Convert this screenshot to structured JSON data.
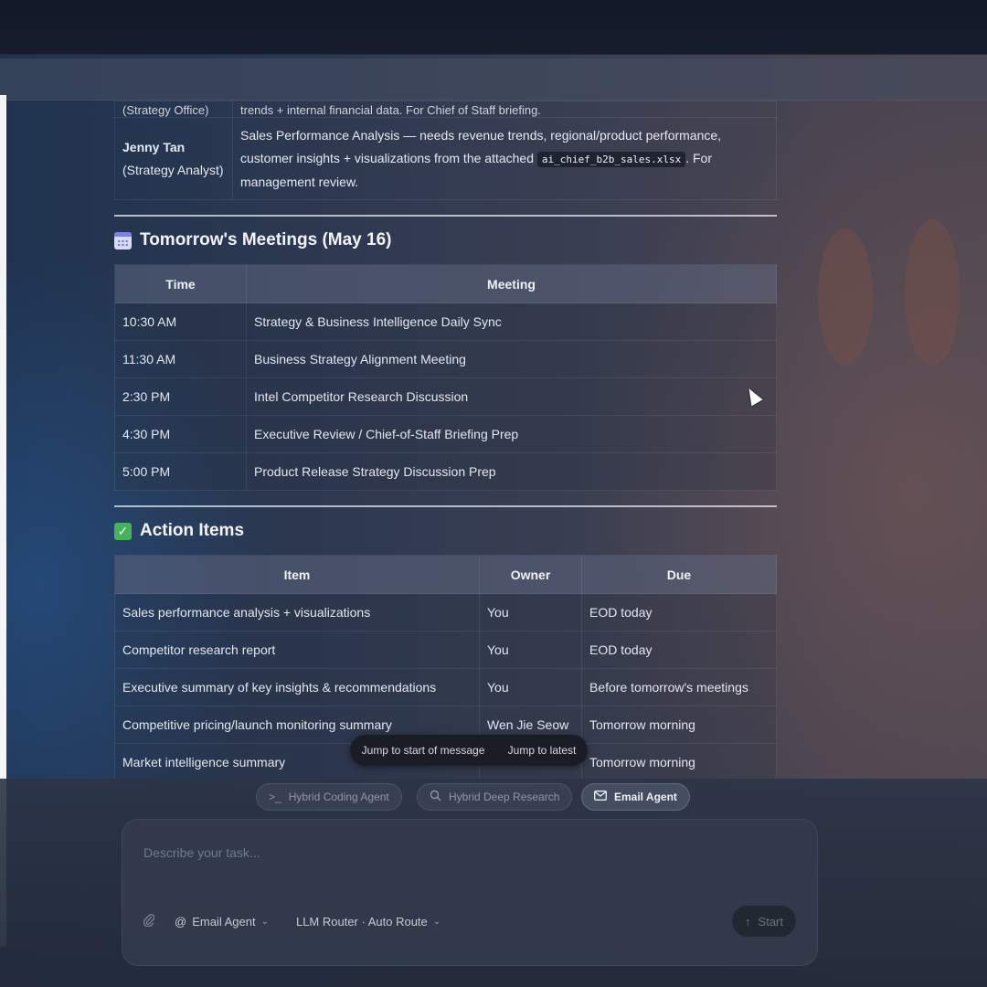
{
  "previous_row": {
    "who": "(Strategy Office)",
    "text": "trends + internal financial data. For Chief of Staff briefing."
  },
  "request_row": {
    "name": "Jenny Tan",
    "role": "(Strategy Analyst)",
    "text_before": "Sales Performance Analysis — needs revenue trends, regional/product performance, customer insights + visualizations from the attached",
    "file": "ai_chief_b2b_sales.xlsx",
    "text_after": ". For management review."
  },
  "meetings": {
    "title": "Tomorrow's Meetings (May 16)",
    "icon": "calendar-icon",
    "headers": [
      "Time",
      "Meeting"
    ],
    "rows": [
      {
        "time": "10:30 AM",
        "meeting": "Strategy & Business Intelligence Daily Sync"
      },
      {
        "time": "11:30 AM",
        "meeting": "Business Strategy Alignment Meeting"
      },
      {
        "time": "2:30 PM",
        "meeting": "Intel Competitor Research Discussion"
      },
      {
        "time": "4:30 PM",
        "meeting": "Executive Review / Chief-of-Staff Briefing Prep"
      },
      {
        "time": "5:00 PM",
        "meeting": "Product Release Strategy Discussion Prep"
      }
    ]
  },
  "actions": {
    "title": "Action Items",
    "icon": "check-icon",
    "headers": [
      "Item",
      "Owner",
      "Due"
    ],
    "rows": [
      {
        "item": "Sales performance analysis + visualizations",
        "owner": "You",
        "due": "EOD today"
      },
      {
        "item": "Competitor research report",
        "owner": "You",
        "due": "EOD today"
      },
      {
        "item": "Executive summary of key insights & recommendations",
        "owner": "You",
        "due": "Before tomorrow's meetings"
      },
      {
        "item": "Competitive pricing/launch monitoring summary",
        "owner": "Wen Jie Seow",
        "due": "Tomorrow morning"
      },
      {
        "item": "Market intelligence summary",
        "owner": "",
        "due": "Tomorrow morning"
      }
    ]
  },
  "jump": {
    "start": "Jump to start of message",
    "latest": "Jump to latest"
  },
  "agents": [
    {
      "label": "Hybrid Coding Agent",
      "icon": "terminal-icon",
      "active": false
    },
    {
      "label": "Hybrid Deep Research",
      "icon": "search-icon",
      "active": false
    },
    {
      "label": "Email Agent",
      "icon": "mail-icon",
      "active": true
    }
  ],
  "composer": {
    "placeholder": "Describe your task...",
    "agent_select": "Email Agent",
    "router_select": "LLM Router · Auto Route",
    "start_label": "Start"
  }
}
